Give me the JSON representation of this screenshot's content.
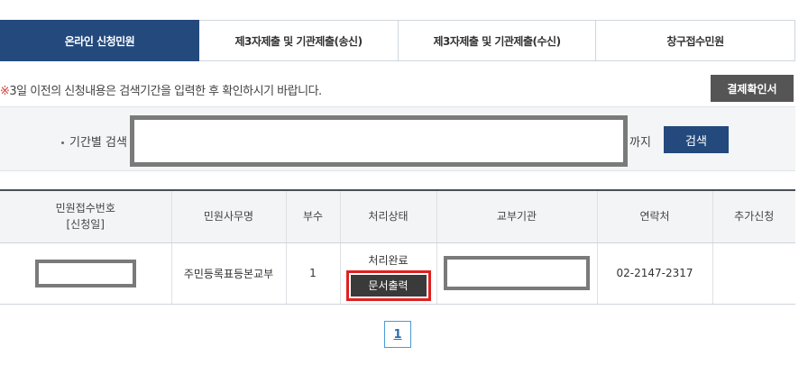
{
  "tabs": [
    {
      "label": "온라인 신청민원",
      "active": true
    },
    {
      "label": "제3자제출 및 기관제출(송신)",
      "active": false
    },
    {
      "label": "제3자제출 및 기관제출(수신)",
      "active": false
    },
    {
      "label": "창구접수민원",
      "active": false
    }
  ],
  "notice": {
    "mark": "※",
    "text": "3일 이전의 신청내용은 검색기간을 입력한 후 확인하시기 바랍니다."
  },
  "pay_confirm_button": "결제확인서",
  "search": {
    "label": "기간별 검색",
    "until": "까지",
    "button": "검색"
  },
  "table": {
    "headers": {
      "receipt_no": "민원접수번호",
      "receipt_no_sub": "[신청일]",
      "office_name": "민원사무명",
      "copies": "부수",
      "status": "처리상태",
      "issuer": "교부기관",
      "contact": "연락처",
      "extra": "추가신청"
    },
    "rows": [
      {
        "office_name": "주민등록표등본교부",
        "copies": "1",
        "status": "처리완료",
        "print_button": "문서출력",
        "contact": "02-2147-2317",
        "extra": ""
      }
    ]
  },
  "pagination": {
    "current": "1"
  },
  "colors": {
    "primary": "#244a7d",
    "highlight": "#e02020",
    "redaction": "#7a7a7a"
  }
}
